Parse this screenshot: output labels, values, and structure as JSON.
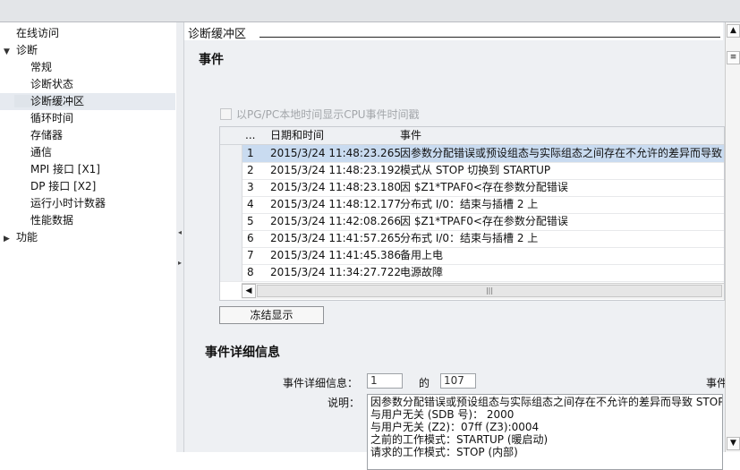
{
  "sidebar": {
    "items": [
      {
        "label": "在线访问",
        "indent": 0,
        "arrow": ""
      },
      {
        "label": "诊断",
        "indent": 0,
        "arrow": "expanded"
      },
      {
        "label": "常规",
        "indent": 1,
        "arrow": ""
      },
      {
        "label": "诊断状态",
        "indent": 1,
        "arrow": ""
      },
      {
        "label": "诊断缓冲区",
        "indent": 1,
        "arrow": "",
        "selected": true
      },
      {
        "label": "循环时间",
        "indent": 1,
        "arrow": ""
      },
      {
        "label": "存储器",
        "indent": 1,
        "arrow": ""
      },
      {
        "label": "通信",
        "indent": 1,
        "arrow": ""
      },
      {
        "label": "MPI 接口 [X1]",
        "indent": 1,
        "arrow": ""
      },
      {
        "label": "DP 接口 [X2]",
        "indent": 1,
        "arrow": ""
      },
      {
        "label": "运行小时计数器",
        "indent": 1,
        "arrow": ""
      },
      {
        "label": "性能数据",
        "indent": 1,
        "arrow": ""
      },
      {
        "label": "功能",
        "indent": 0,
        "arrow": "collapsed"
      }
    ]
  },
  "main": {
    "section_title": "诊断缓冲区",
    "events_title": "事件",
    "checkbox_label": "以PG/PC本地时间显示CPU事件时间戳",
    "table": {
      "headers": [
        "...",
        "日期和时间",
        "事件"
      ],
      "rows": [
        {
          "n": "1",
          "time": "2015/3/24 11:48:23.265",
          "event": "因参数分配错误或预设组态与实际组态之间存在不允许的差异而导致"
        },
        {
          "n": "2",
          "time": "2015/3/24 11:48:23.192",
          "event": "模式从 STOP 切换到 STARTUP"
        },
        {
          "n": "3",
          "time": "2015/3/24 11:48:23.180",
          "event": "因 $Z1*TPAF0<存在参数分配错误"
        },
        {
          "n": "4",
          "time": "2015/3/24 11:48:12.177",
          "event": "分布式 I/0：结束与插槽  2 上"
        },
        {
          "n": "5",
          "time": "2015/3/24 11:42:08.266",
          "event": "因 $Z1*TPAF0<存在参数分配错误"
        },
        {
          "n": "6",
          "time": "2015/3/24 11:41:57.265",
          "event": "分布式 I/0：结束与插槽  2 上"
        },
        {
          "n": "7",
          "time": "2015/3/24 11:41:45.386",
          "event": "备用上电"
        },
        {
          "n": "8",
          "time": "2015/3/24 11:34:27.722",
          "event": "电源故障"
        }
      ],
      "selected_row": 0
    },
    "freeze_button": "冻结显示",
    "details_title": "事件详细信息",
    "details_label": "事件详细信息：",
    "details_index": "1",
    "details_of": "的",
    "details_total": "107",
    "details_right_label": "事件",
    "description_label": "说明：",
    "description_lines": [
      "因参数分配错误或预设组态与实际组态之间存在不允许的差异而导致 STOP",
      "与用户无关 (SDB 号)：  2000",
      "与用户无关 (Z2)：07ff (Z3):0004",
      "之前的工作模式：STARTUP (暖启动)",
      "请求的工作模式：STOP (内部)"
    ]
  },
  "icons": {
    "expanded": "triangle-down-icon",
    "collapsed": "triangle-right-icon"
  }
}
